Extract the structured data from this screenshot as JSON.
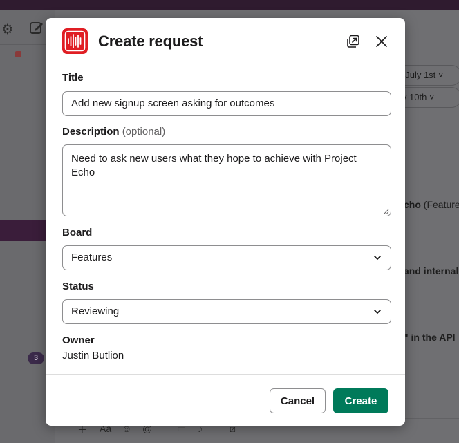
{
  "background": {
    "pill_dates": [
      ", July 1st",
      "ly 10th"
    ],
    "snippets": [
      {
        "bold": "cho",
        "rest": " (Features"
      },
      {
        "bold": "and internal",
        "rest": ""
      },
      {
        "bold": "\" in the API",
        "rest": ""
      }
    ],
    "badge_count": "3",
    "toolbar_format_label": "Aa"
  },
  "modal": {
    "title": "Create request",
    "logo_icon": "echo-waveform-icon",
    "logo_color": "#e01e24",
    "fields": {
      "title": {
        "label": "Title",
        "value": "Add new signup screen asking for outcomes"
      },
      "description": {
        "label": "Description",
        "optional": "(optional)",
        "value": "Need to ask new users what they hope to achieve with Project Echo"
      },
      "board": {
        "label": "Board",
        "value": "Features"
      },
      "status": {
        "label": "Status",
        "value": "Reviewing"
      },
      "owner": {
        "label": "Owner",
        "value": "Justin Butlion"
      }
    },
    "buttons": {
      "cancel": "Cancel",
      "create": "Create"
    },
    "colors": {
      "primary": "#007a5a"
    }
  }
}
